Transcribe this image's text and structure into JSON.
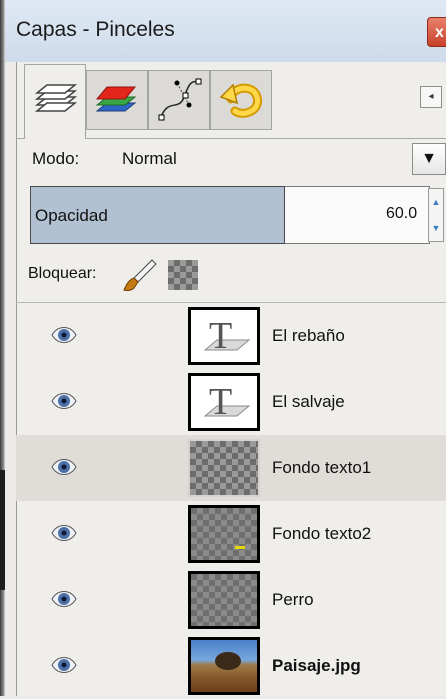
{
  "window": {
    "title": "Capas - Pinceles",
    "close_glyph": "x"
  },
  "tabs": [
    {
      "name": "layers-tab-icon",
      "active": true
    },
    {
      "name": "channels-tab-icon",
      "active": false
    },
    {
      "name": "paths-tab-icon",
      "active": false
    },
    {
      "name": "undo-history-tab-icon",
      "active": false
    }
  ],
  "tab_menu_glyph": "◂",
  "mode": {
    "label": "Modo:",
    "value": "Normal",
    "dropdown_glyph": "▼"
  },
  "opacity": {
    "label": "Opacidad",
    "value": "60.0",
    "fill": 0.6,
    "spin_up": "▲",
    "spin_down": "▼"
  },
  "lock": {
    "label": "Bloquear:"
  },
  "layers": [
    {
      "name": "El rebaño",
      "type": "text",
      "visible": true,
      "selected": false,
      "bold": false
    },
    {
      "name": "El salvaje",
      "type": "text",
      "visible": true,
      "selected": false,
      "bold": false
    },
    {
      "name": "Fondo texto1",
      "type": "transparent",
      "visible": true,
      "selected": true,
      "bold": false
    },
    {
      "name": "Fondo texto2",
      "type": "transparent-dark",
      "visible": true,
      "selected": false,
      "bold": false
    },
    {
      "name": "Perro",
      "type": "transparent-dark",
      "visible": true,
      "selected": false,
      "bold": false
    },
    {
      "name": "Paisaje.jpg",
      "type": "image",
      "visible": true,
      "selected": false,
      "bold": true
    }
  ],
  "colors": {
    "opacity_bar": "#b1c1d1",
    "selected_row": "#e0ddd9",
    "close_button": "#c8412a"
  }
}
